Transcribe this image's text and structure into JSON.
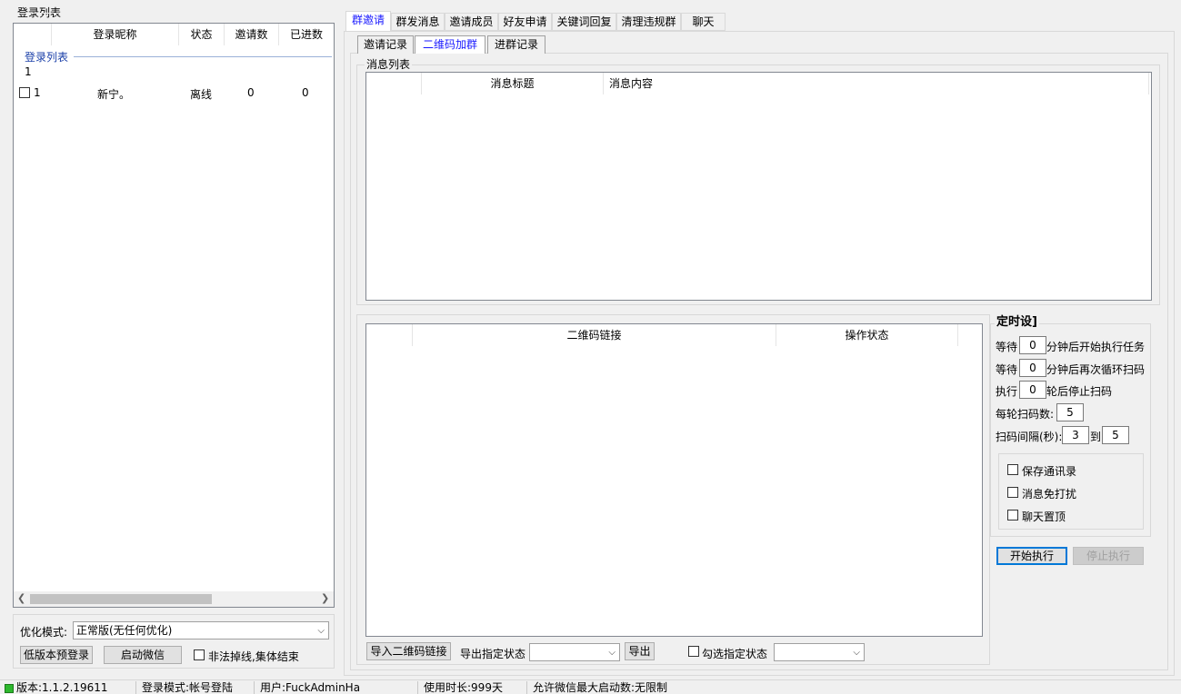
{
  "left": {
    "group_title": "登录列表",
    "columns": [
      "登录昵称",
      "状态",
      "邀请数",
      "已进数"
    ],
    "group_header": "登录列表",
    "group_count": "1",
    "rows": [
      {
        "id": "1",
        "nickname": "新宁。",
        "status": "离线",
        "invites": "0",
        "joined": "0"
      }
    ],
    "optimize_label": "优化模式:",
    "optimize_value": "正常版(无任何优化)",
    "btn_low": "低版本预登录",
    "btn_start_wechat": "启动微信",
    "illegal_label": "非法掉线,集体结束"
  },
  "tabs": [
    "群邀请",
    "群发消息",
    "邀请成员",
    "好友申请",
    "关键词回复",
    "清理违规群",
    "聊天"
  ],
  "subtabs": [
    "邀请记录",
    "二维码加群",
    "进群记录"
  ],
  "msg_list": {
    "title": "消息列表",
    "columns": [
      "消息标题",
      "消息内容"
    ]
  },
  "qr_list": {
    "columns": [
      "二维码链接",
      "操作状态"
    ]
  },
  "timer": {
    "title": "定时设]",
    "wait_prefix": "等待",
    "wait1_value": "0",
    "wait1_suffix": "分钟后开始执行任务",
    "wait2_value": "0",
    "wait2_suffix": "分钟后再次循环扫码",
    "exec_prefix": "执行",
    "exec_value": "0",
    "exec_suffix": "轮后停止扫码",
    "per_round_label": "每轮扫码数:",
    "per_round_value": "5",
    "interval_label": "扫码间隔(秒):",
    "interval_from": "3",
    "interval_to_label": "到",
    "interval_to": "5",
    "opt_save": "保存通讯录",
    "opt_mute": "消息免打扰",
    "opt_top": "聊天置顶",
    "btn_start": "开始执行",
    "btn_stop": "停止执行"
  },
  "bottom": {
    "btn_import": "导入二维码链接",
    "export_label": "导出指定状态",
    "btn_export": "导出",
    "check_label": "勾选指定状态"
  },
  "status": {
    "version": "版本:1.1.2.19611",
    "login_mode": "登录模式:帐号登陆",
    "user": "用户:FuckAdminHa",
    "usage": "使用时长:999天",
    "max_start": "允许微信最大启动数:无限制"
  },
  "colors": {
    "accent": "#1a1aff",
    "status_green": "#2db82d"
  }
}
